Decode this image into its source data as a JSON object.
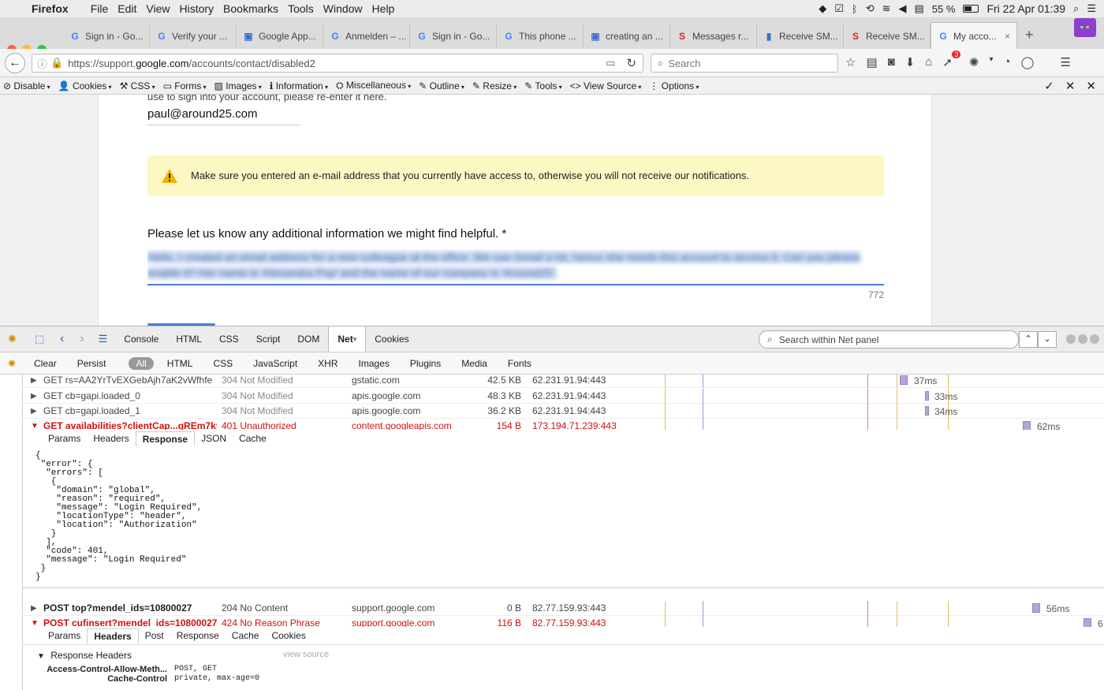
{
  "mac_menubar": {
    "app": "Firefox",
    "menus": [
      "File",
      "Edit",
      "View",
      "History",
      "Bookmarks",
      "Tools",
      "Window",
      "Help"
    ],
    "battery": "55 %",
    "clock": "Fri 22 Apr  01:39"
  },
  "tabs": [
    {
      "label": "Sign in - Go...",
      "icon": "G"
    },
    {
      "label": "Verify your ...",
      "icon": "G"
    },
    {
      "label": "Google App...",
      "icon": "▣"
    },
    {
      "label": "Anmelden – ...",
      "icon": "G"
    },
    {
      "label": "Sign in - Go...",
      "icon": "G"
    },
    {
      "label": "This phone ...",
      "icon": "G"
    },
    {
      "label": "creating an ...",
      "icon": "▣"
    },
    {
      "label": "Messages r...",
      "icon": "S"
    },
    {
      "label": "Receive SM...",
      "icon": "▮"
    },
    {
      "label": "Receive SM...",
      "icon": "S"
    },
    {
      "label": "My acco...",
      "icon": "G",
      "active": true
    }
  ],
  "navbar": {
    "url_prefix": "https://support.",
    "url_domain": "google.com",
    "url_path": "/accounts/contact/disabled2",
    "search_placeholder": "Search",
    "badge_count": "3"
  },
  "dev_toolbar": [
    "Disable",
    "Cookies",
    "CSS",
    "Forms",
    "Images",
    "Information",
    "Miscellaneous",
    "Outline",
    "Resize",
    "Tools",
    "View Source",
    "Options"
  ],
  "page": {
    "truncated_text": "use to sign into your account, please re-enter it here.",
    "email": "paul@around25.com",
    "warning": "Make sure you entered an e-mail address that you currently have access to, otherwise you will not receive our notifications.",
    "question": "Please let us know any additional information we might find helpful. *",
    "blurred_text_1": "Hello. I created an email address for a new colleague at the office. We use Gmail a lot, hence she needs this account to access it. Can you please",
    "blurred_text_2": "enable it? Her name is 'Alexandra Pop' and the name of our company is 'Around25'.",
    "char_count": "772"
  },
  "firebug": {
    "tabs": [
      "Console",
      "HTML",
      "CSS",
      "Script",
      "DOM",
      "Net",
      "Cookies"
    ],
    "active_tab": "Net",
    "search_placeholder": "Search within Net panel",
    "filters": [
      "Clear",
      "Persist",
      "All",
      "HTML",
      "CSS",
      "JavaScript",
      "XHR",
      "Images",
      "Plugins",
      "Media",
      "Fonts"
    ],
    "rows": [
      {
        "method_url": "GET rs=AA2YrTvEXGebAjh7aK2vWfhfe",
        "status": "304 Not Modified",
        "domain": "gstatic.com",
        "size": "42.5 KB",
        "ip": "62.231.91.94:443",
        "time": "37ms"
      },
      {
        "method_url": "GET cb=gapi.loaded_0",
        "status": "304 Not Modified",
        "domain": "apis.google.com",
        "size": "48.3 KB",
        "ip": "62.231.91.94:443",
        "time": "33ms"
      },
      {
        "method_url": "GET cb=gapi.loaded_1",
        "status": "304 Not Modified",
        "domain": "apis.google.com",
        "size": "36.2 KB",
        "ip": "62.231.91.94:443",
        "time": "34ms"
      },
      {
        "method_url": "GET availabilities?clientCap...qREm7kf",
        "status": "401 Unauthorized",
        "domain": "content.googleapis.com",
        "size": "154 B",
        "ip": "173.194.71.239:443",
        "time": "62ms"
      },
      {
        "method_url": "POST top?mendel_ids=10800027",
        "status": "204 No Content",
        "domain": "support.google.com",
        "size": "0 B",
        "ip": "82.77.159.93:443",
        "time": "56ms"
      },
      {
        "method_url": "POST cufinsert?mendel_ids=10800027",
        "status": "424 No Reason Phrase",
        "domain": "support.google.com",
        "size": "116 B",
        "ip": "82.77.159.93:443",
        "time": "6"
      }
    ],
    "response_subtabs": [
      "Params",
      "Headers",
      "Response",
      "JSON",
      "Cache"
    ],
    "response_body": "{\n \"error\": {\n  \"errors\": [\n   {\n    \"domain\": \"global\",\n    \"reason\": \"required\",\n    \"message\": \"Login Required\",\n    \"locationType\": \"header\",\n    \"location\": \"Authorization\"\n   }\n  ],\n  \"code\": 401,\n  \"message\": \"Login Required\"\n }\n}",
    "headers_subtabs": [
      "Params",
      "Headers",
      "Post",
      "Response",
      "Cache",
      "Cookies"
    ],
    "response_headers_title": "Response Headers",
    "view_source": "view source",
    "headers": [
      {
        "name": "Access-Control-Allow-Meth...",
        "value": "POST, GET"
      },
      {
        "name": "Cache-Control",
        "value": "private, max-age=0"
      }
    ]
  }
}
